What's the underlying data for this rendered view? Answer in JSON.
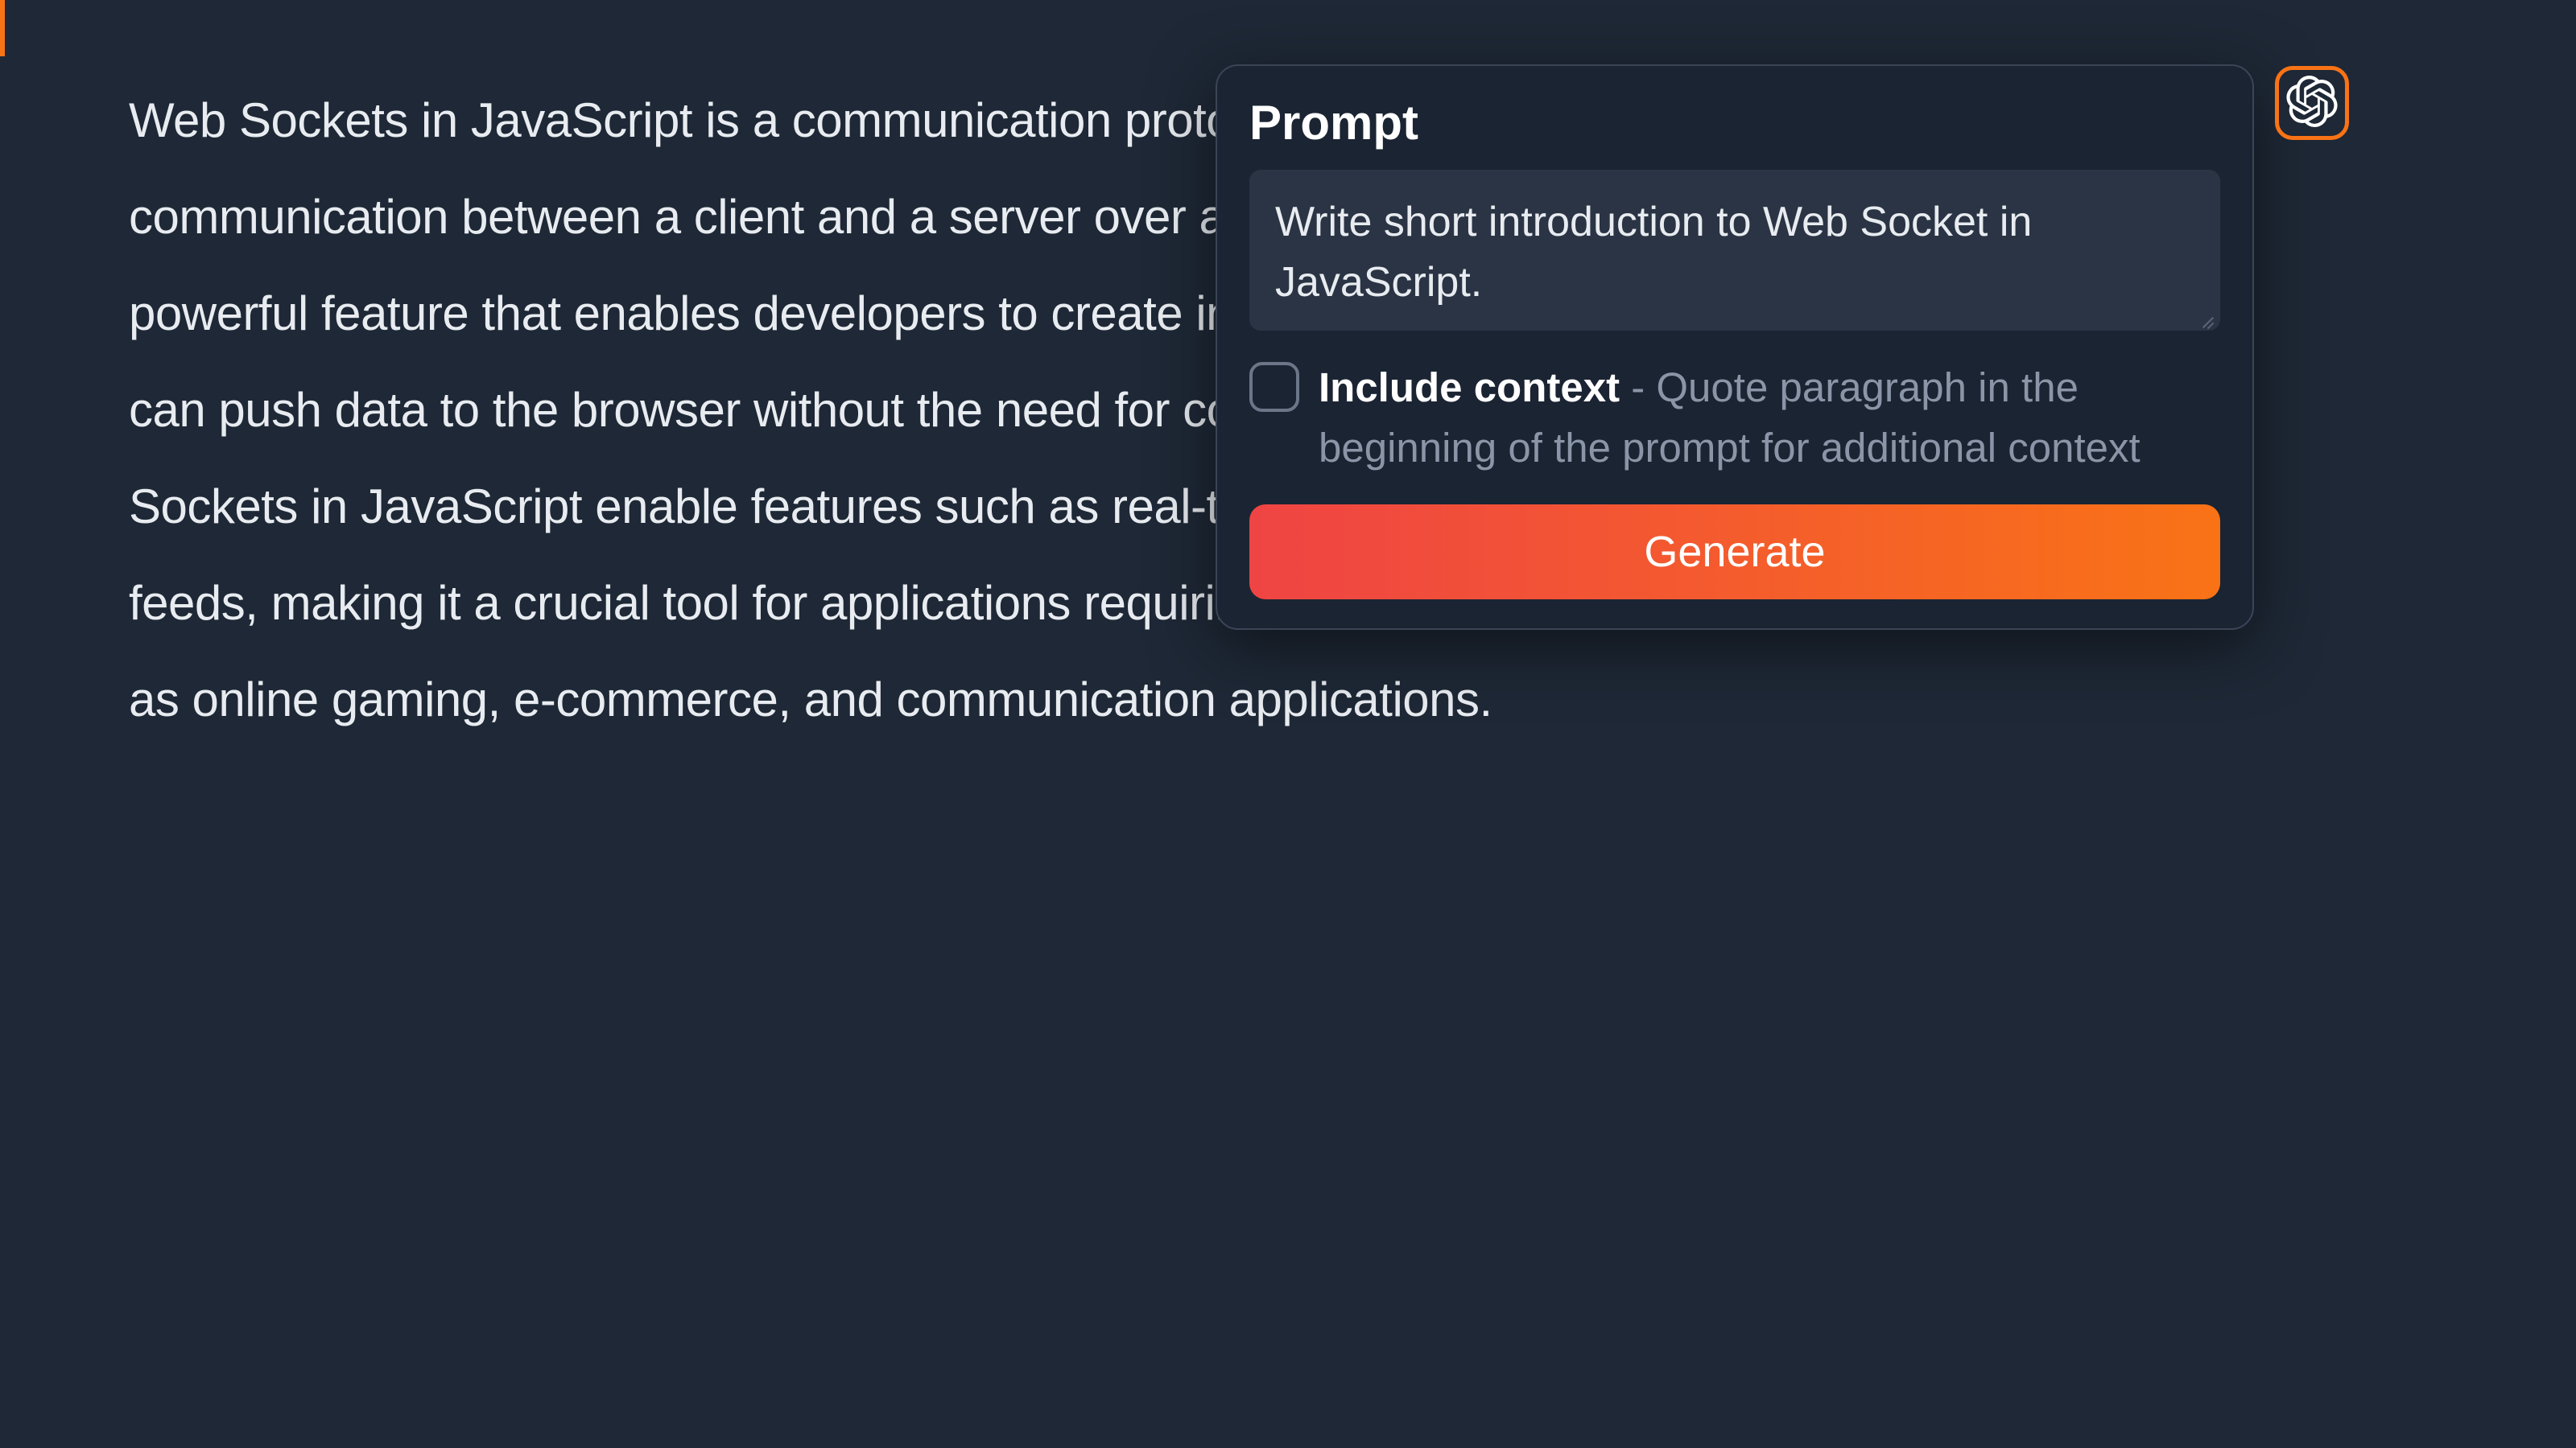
{
  "content": {
    "paragraph": "Web Sockets in JavaScript is a communication protocol that allows for real-time, bidirectional communication between a client and a server over a single, long-lived connection. It is a powerful feature that enables developers to create interactive, dynamic web applications that can push data to the browser without the need for constant or continuous polling. Web Sockets in JavaScript enable features such as real-time updates, notifications, and live data feeds, making it a crucial tool for applications requiring fast and reliable communication, such as online gaming, e-commerce, and communication applications."
  },
  "prompt_panel": {
    "title": "Prompt",
    "textarea_value": "Write short introduction to Web Socket in JavaScript.",
    "include_context_label": "Include context",
    "include_context_description": " - Quote paragraph in the beginning of the prompt for additional context",
    "generate_label": "Generate"
  },
  "colors": {
    "accent": "#f97316",
    "background": "#1e2836",
    "panel": "#1b2432",
    "textarea": "#2a3444"
  }
}
